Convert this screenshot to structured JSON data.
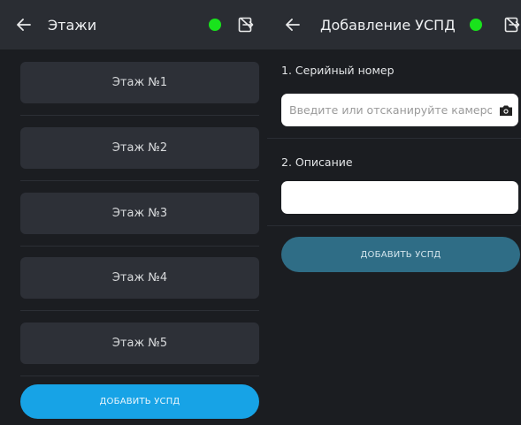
{
  "colors": {
    "status_online": "#19e31c",
    "primary_button": "#17a3e6",
    "primary_button_disabled": "#2f6d86",
    "background": "#1b1d21",
    "topbar": "#2a2d33"
  },
  "floors_screen": {
    "title": "Этажи",
    "icons": {
      "back": "arrow-left-icon",
      "status": "status-dot-icon",
      "exit": "logout-icon"
    },
    "floors": [
      {
        "label": "Этаж №1"
      },
      {
        "label": "Этаж №2"
      },
      {
        "label": "Этаж №3"
      },
      {
        "label": "Этаж №4"
      },
      {
        "label": "Этаж №5"
      }
    ],
    "add_button_label": "ДОБАВИТЬ УСПД"
  },
  "add_device_screen": {
    "title": "Добавление УСПД",
    "icons": {
      "back": "arrow-left-icon",
      "status": "status-dot-icon",
      "exit": "logout-icon",
      "camera": "camera-icon"
    },
    "serial": {
      "label": "1. Серийный номер",
      "placeholder": "Введите или отсканируйте камерой",
      "value": ""
    },
    "description": {
      "label": "2. Описание",
      "placeholder": "",
      "value": ""
    },
    "add_button_label": "ДОБАВИТЬ УСПД"
  }
}
